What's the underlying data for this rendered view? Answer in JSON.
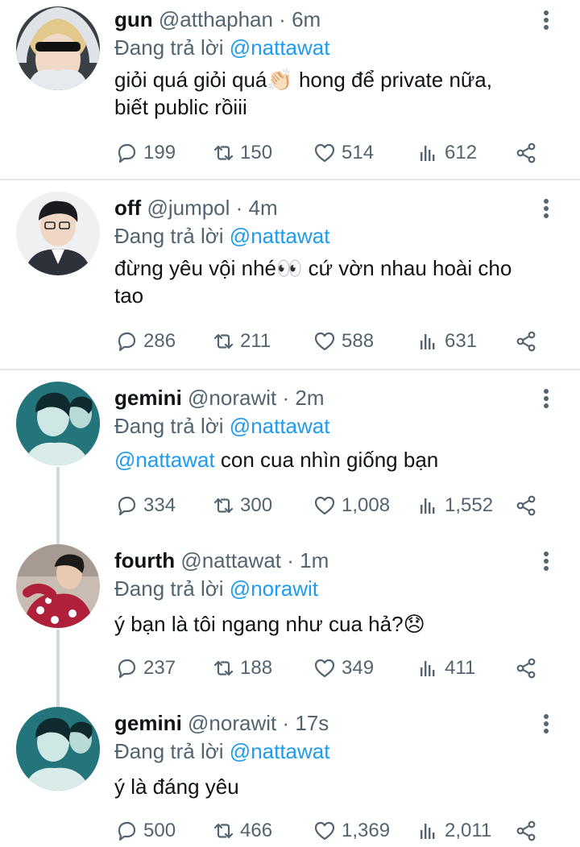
{
  "tweets": [
    {
      "name": "gun",
      "handle": "@atthaphan",
      "time": "6m",
      "reply_prefix": "Đang trả lời",
      "reply_to": "@nattawat",
      "text_line1": "giỏi quá giỏi quá👏🏻 hong để private nữa,",
      "text_line2": "biết public rồiii",
      "replies": "199",
      "retweets": "150",
      "likes": "514",
      "views": "612"
    },
    {
      "name": "off",
      "handle": "@jumpol",
      "time": "4m",
      "reply_prefix": "Đang trả lời",
      "reply_to": "@nattawat",
      "text_line1": "đừng yêu vội nhé👀 cứ vờn nhau hoài cho",
      "text_line2": "tao",
      "replies": "286",
      "retweets": "211",
      "likes": "588",
      "views": "631"
    },
    {
      "name": "gemini",
      "handle": "@norawit",
      "time": "2m",
      "reply_prefix": "Đang trả lời",
      "reply_to": "@nattawat",
      "text_mention": "@nattawat",
      "text_rest": " con cua nhìn giống bạn",
      "replies": "334",
      "retweets": "300",
      "likes": "1,008",
      "views": "1,552"
    },
    {
      "name": "fourth",
      "handle": "@nattawat",
      "time": "1m",
      "reply_prefix": "Đang trả lời",
      "reply_to": "@norawit",
      "text_line1": "ý bạn là tôi ngang như cua hả?😞",
      "replies": "237",
      "retweets": "188",
      "likes": "349",
      "views": "411"
    },
    {
      "name": "gemini",
      "handle": "@norawit",
      "time": "17s",
      "reply_prefix": "Đang trả lời",
      "reply_to": "@nattawat",
      "text_line1": "ý là đáng yêu",
      "replies": "500",
      "retweets": "466",
      "likes": "1,369",
      "views": "2,011"
    }
  ],
  "icons": {
    "reply": "reply-icon",
    "retweet": "retweet-icon",
    "like": "heart-icon",
    "views": "views-icon",
    "share": "share-icon",
    "more": "more-options-icon"
  },
  "colors": {
    "link": "#1d9bf0",
    "muted": "#536471",
    "text": "#0f1419"
  }
}
